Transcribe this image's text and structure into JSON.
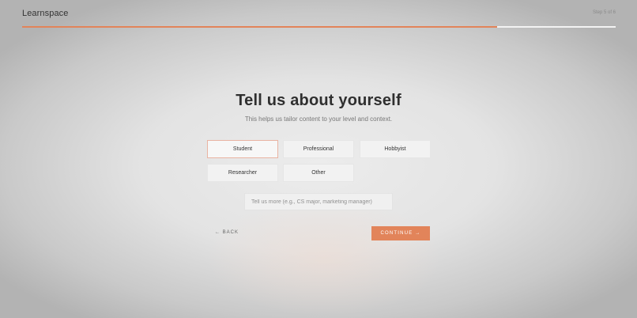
{
  "header": {
    "brand": "Learnspace",
    "step_label": "Step 5 of 6",
    "progress": 0.8
  },
  "main": {
    "title": "Tell us about yourself",
    "subtitle": "This helps us tailor content to your level and context.",
    "options": [
      {
        "label": "Student",
        "selected": true
      },
      {
        "label": "Professional",
        "selected": false
      },
      {
        "label": "Hobbyist",
        "selected": false
      },
      {
        "label": "Researcher",
        "selected": false
      },
      {
        "label": "Other",
        "selected": false
      }
    ],
    "details_input": {
      "value": "",
      "placeholder": "Tell us more (e.g., CS major, marketing manager)"
    }
  },
  "footer": {
    "back_label": "← BACK",
    "continue_label": "CONTINUE →"
  },
  "colors": {
    "accent": "#e2845a",
    "selected_border": "#e9b3a2"
  }
}
